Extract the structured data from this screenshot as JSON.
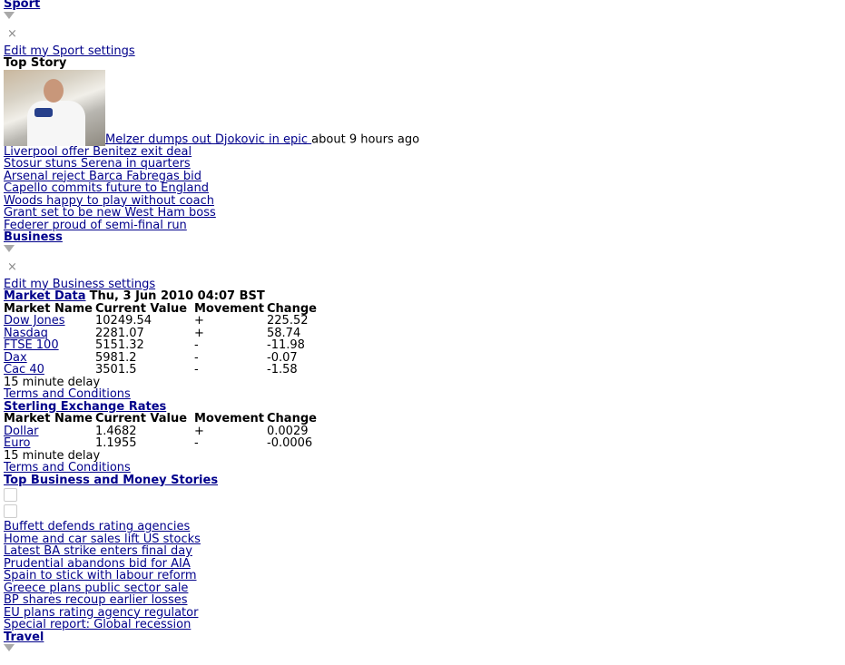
{
  "sport": {
    "title": "Sport",
    "close": "×",
    "edit_link": "Edit my Sport settings",
    "top_story_label": "Top Story",
    "top_story": {
      "headline": "Melzer dumps out Djokovic in epic ",
      "time": "about 9 hours ago"
    },
    "stories": [
      "Liverpool offer Benitez exit deal",
      "Stosur stuns Serena in quarters",
      "Arsenal reject Barca Fabregas bid",
      "Capello commits future to England",
      "Woods happy to play without coach",
      "Grant set to be new West Ham boss",
      "Federer proud of semi-final run"
    ]
  },
  "business": {
    "title": "Business",
    "close": "×",
    "edit_link": "Edit my Business settings",
    "market": {
      "title": "Market Data",
      "date": "Thu, 3 Jun 2010 04:07 BST",
      "headers": [
        "Market Name",
        "Current Value",
        "Movement",
        "Change"
      ],
      "rows": [
        [
          "Dow Jones",
          "10249.54",
          "+",
          "225.52"
        ],
        [
          "Nasdaq",
          "2281.07",
          "+",
          "58.74"
        ],
        [
          "FTSE 100",
          "5151.32",
          "-",
          "-11.98"
        ],
        [
          "Dax",
          "5981.2",
          "-",
          "-0.07"
        ],
        [
          "Cac 40",
          "3501.5",
          "-",
          "-1.58"
        ]
      ],
      "delay": "15 minute delay",
      "terms": "Terms and Conditions"
    },
    "exchange": {
      "title": "Sterling Exchange Rates",
      "headers": [
        "Market Name",
        "Current Value",
        "Movement",
        "Change"
      ],
      "rows": [
        [
          "Dollar",
          "1.4682",
          "+",
          "0.0029"
        ],
        [
          "Euro",
          "1.1955",
          "-",
          "-0.0006"
        ]
      ],
      "delay": "15 minute delay",
      "terms": "Terms and Conditions"
    },
    "top_stories_title": "Top Business and Money Stories",
    "stories": [
      "Buffett defends rating agencies",
      "Home and car sales lift US stocks",
      "Latest BA strike enters final day",
      "Prudential abandons bid for AIA",
      "Spain to stick with labour reform",
      "Greece plans public sector sale",
      "BP shares recoup earlier losses",
      "EU plans rating agency regulator",
      "Special report: Global recession"
    ]
  },
  "travel": {
    "title": "Travel"
  }
}
